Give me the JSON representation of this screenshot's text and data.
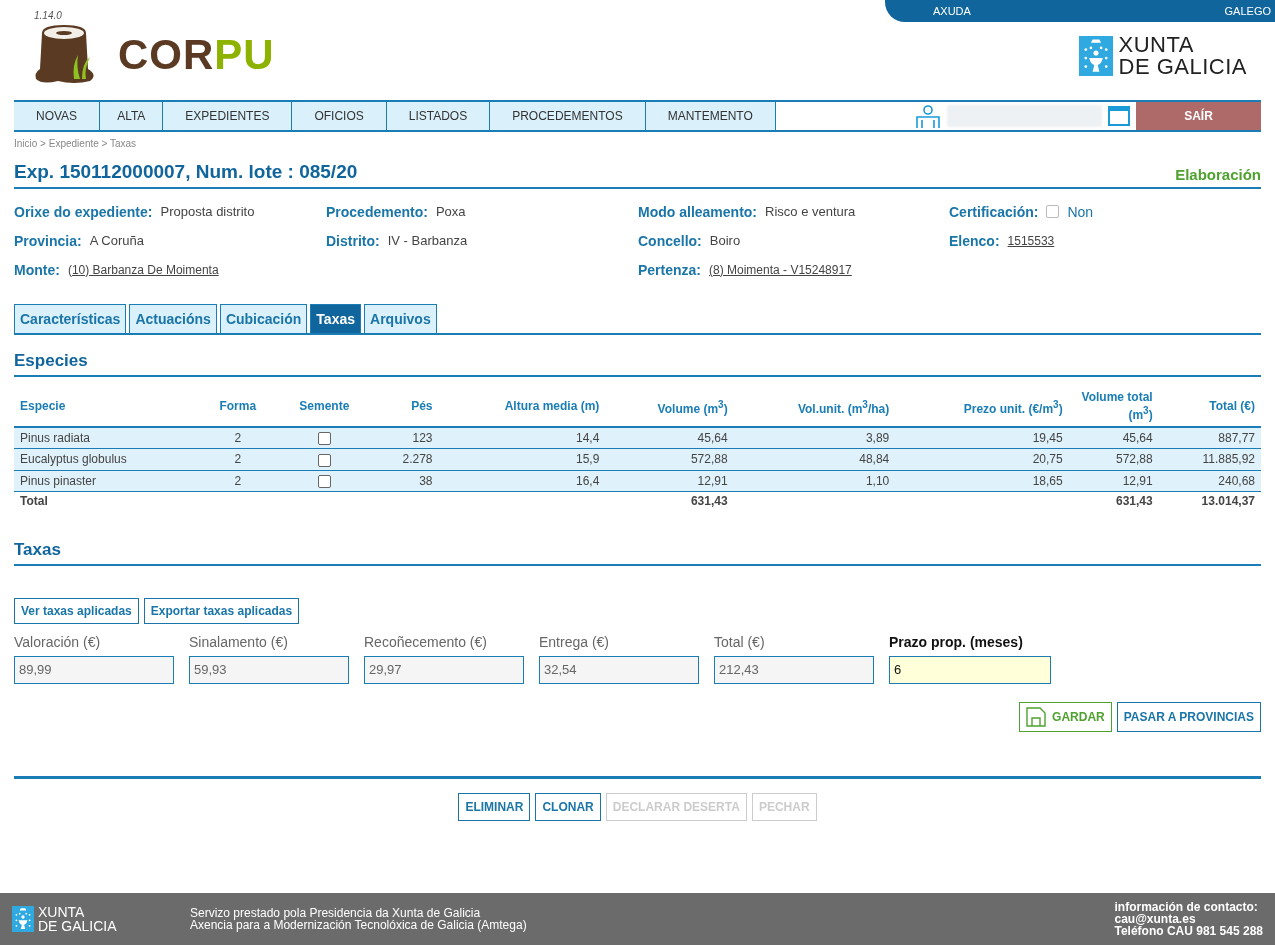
{
  "header": {
    "version": "1.14.0",
    "logo": [
      "COR",
      "PU"
    ],
    "top_links": [
      "AXUDA",
      "GALEGO"
    ],
    "xunta_logo": [
      "XUNTA",
      "DE GALICIA"
    ]
  },
  "nav": {
    "items": [
      {
        "label": "NOVAS",
        "selected": false
      },
      {
        "label": "ALTA",
        "selected": false
      },
      {
        "label": "EXPEDIENTES",
        "selected": false
      },
      {
        "label": "OFICIOS",
        "selected": false
      },
      {
        "label": "LISTADOS",
        "selected": false
      },
      {
        "label": "PROCEDEMENTOS",
        "selected": false
      },
      {
        "label": "MANTEMENTO",
        "selected": false
      }
    ],
    "logout": "SAÍR"
  },
  "breadcrumb": "Inicio > Expediente > Taxas",
  "title": "Exp. 150112000007, Num. lote : 085/20",
  "status": "Elaboración",
  "info_columns": [
    [
      {
        "kind": "text",
        "label": "Orixe do expediente:",
        "value": "Proposta distrito"
      },
      {
        "kind": "text",
        "label": "Provincia:",
        "value": "A Coruña"
      },
      {
        "kind": "link",
        "label": "Monte:",
        "value": "(10) Barbanza De Moimenta"
      }
    ],
    [
      {
        "kind": "text",
        "label": "Procedemento:",
        "value": "Poxa"
      },
      {
        "kind": "text",
        "label": "Distrito:",
        "value": "IV - Barbanza"
      }
    ],
    [
      {
        "kind": "text",
        "label": "Modo alleamento:",
        "value": "Risco e ventura"
      },
      {
        "kind": "text",
        "label": "Concello:",
        "value": "Boiro"
      },
      {
        "kind": "link",
        "label": "Pertenza:",
        "value": "(8) Moimenta - V15248917"
      }
    ],
    [
      {
        "kind": "checkbox",
        "label": "Certificación:",
        "value": "Non",
        "checked": false
      },
      {
        "kind": "link",
        "label": "Elenco:",
        "value": "1515533"
      }
    ]
  ],
  "tabs": [
    {
      "label": "Características",
      "selected": false
    },
    {
      "label": "Actuacións",
      "selected": false
    },
    {
      "label": "Cubicación",
      "selected": false
    },
    {
      "label": "Taxas",
      "selected": true
    },
    {
      "label": "Arquivos",
      "selected": false
    }
  ],
  "species": {
    "heading": "Especies",
    "columns": [
      "Especie",
      "Forma",
      "Semente",
      "Pés",
      "Altura media (m)",
      "Volume (m$^{3}$)",
      "Vol.unit. (m$^{3}$/ha)",
      "Prezo unit. (€/m$^{3}$)",
      "Volume total (m$^{3}$)",
      "Total (€)"
    ],
    "rows": [
      {
        "especie": "Pinus radiata",
        "forma": "2",
        "semente": false,
        "pes": "123",
        "altura": "14,4",
        "volume": "45,64",
        "vol_unit": "3,89",
        "prezo": "19,45",
        "volume_total": "45,64",
        "total": "887,77"
      },
      {
        "especie": "Eucalyptus globulus",
        "forma": "2",
        "semente": false,
        "pes": "2.278",
        "altura": "15,9",
        "volume": "572,88",
        "vol_unit": "48,84",
        "prezo": "20,75",
        "volume_total": "572,88",
        "total": "11.885,92"
      },
      {
        "especie": "Pinus pinaster",
        "forma": "2",
        "semente": false,
        "pes": "38",
        "altura": "16,4",
        "volume": "12,91",
        "vol_unit": "1,10",
        "prezo": "18,65",
        "volume_total": "12,91",
        "total": "240,68"
      }
    ],
    "total_row": {
      "label": "Total",
      "volume": "631,43",
      "volume_total": "631,43",
      "total": "13.014,37"
    }
  },
  "taxas": {
    "heading": "Taxas",
    "buttons": [
      "Ver taxas aplicadas",
      "Exportar taxas aplicadas"
    ],
    "fields": [
      {
        "label": "Valoración (€)",
        "value": "89,99",
        "editable": false
      },
      {
        "label": "Sinalamento (€)",
        "value": "59,93",
        "editable": false
      },
      {
        "label": "Recoñecemento (€)",
        "value": "29,97",
        "editable": false
      },
      {
        "label": "Entrega (€)",
        "value": "32,54",
        "editable": false
      },
      {
        "label": "Total (€)",
        "value": "212,43",
        "editable": false
      },
      {
        "label": "Prazo prop. (meses)",
        "value": "6",
        "editable": true
      }
    ],
    "actions": [
      {
        "kind": "save",
        "label": "GARDAR"
      },
      {
        "kind": "plain",
        "label": "PASAR A PROVINCIAS"
      }
    ]
  },
  "bottom_actions": [
    {
      "label": "ELIMINAR",
      "disabled": false
    },
    {
      "label": "CLONAR",
      "disabled": false
    },
    {
      "label": "DECLARAR DESERTA",
      "disabled": true
    },
    {
      "label": "PECHAR",
      "disabled": true
    }
  ],
  "footer": {
    "logo": [
      "XUNTA",
      "DE GALICIA"
    ],
    "lines": [
      "Servizo prestado pola Presidencia da Xunta de Galicia",
      "Axencia para a Modernización Tecnolóxica de Galicia (Amtega)"
    ],
    "contact": [
      "información de contacto:",
      "cau@xunta.es",
      "Teléfono CAU 981 545 288"
    ]
  }
}
